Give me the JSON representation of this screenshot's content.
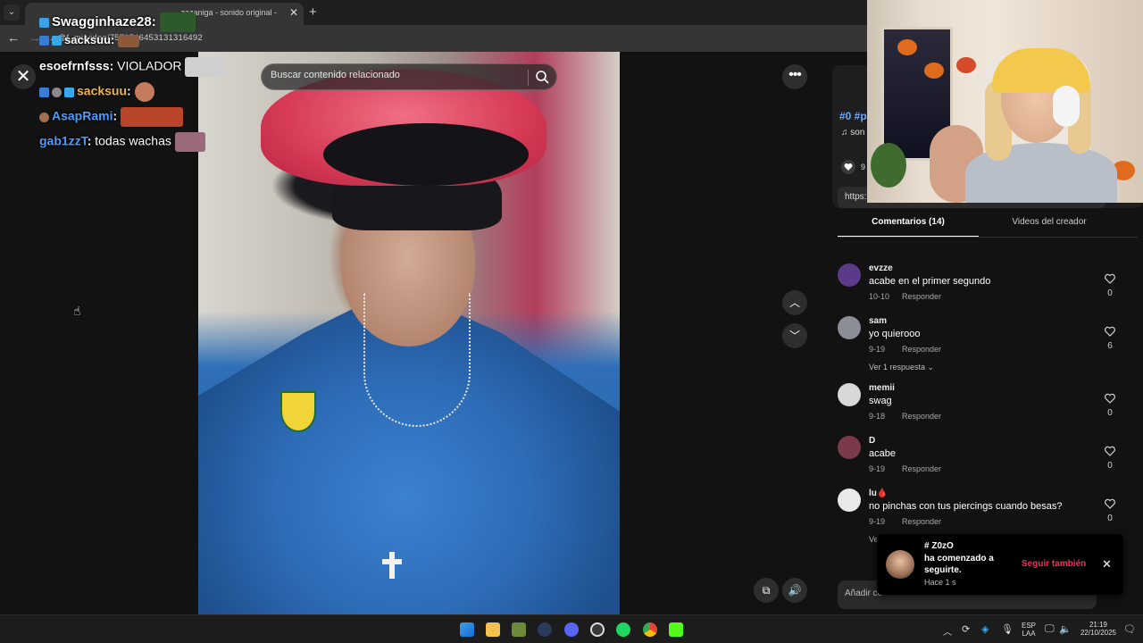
{
  "browser": {
    "tab_title": "·zazaniga - sonido original -",
    "url": "...@f..mi/video/7551546453131316492",
    "new_tab_label": "+",
    "tab_close_label": "✕"
  },
  "page": {
    "search_placeholder": "Buscar contenido relacionado",
    "close_label": "✕",
    "more_label": "•••"
  },
  "chat": [
    {
      "user": "Swagginhaze28",
      "sep": ":",
      "text": "",
      "color": "#ffffff"
    },
    {
      "user": "sacksuu",
      "sep": ":",
      "text": "",
      "color": "#ffffff"
    },
    {
      "user": "esoefrnfsss",
      "sep": ":",
      "text": " VIOLADOR",
      "color": "#ffffff"
    },
    {
      "user": "sacksuu",
      "sep": ":",
      "text": "",
      "color": "#f0b44a"
    },
    {
      "user": "AsapRami",
      "sep": ":",
      "text": "",
      "color": "#4a9cff"
    },
    {
      "user": "gab1zzT",
      "sep": ":",
      "text": " todas wachas",
      "color": "#4a9cff"
    }
  ],
  "panel": {
    "tags": "#0 #p",
    "sound": "♫  son",
    "like_count": "9",
    "link": "https:",
    "tab_comments": "Comentarios (14)",
    "tab_creator": "Videos del creador",
    "add_comment_placeholder": "Añadir co"
  },
  "comments": [
    {
      "user": "evzze",
      "text": "acabe en el primer segundo",
      "date": "10-10",
      "reply": "Responder",
      "likes": "0",
      "more": "",
      "avatar": "#5b3a8a"
    },
    {
      "user": "sam",
      "text": "yo quierooo",
      "date": "9-19",
      "reply": "Responder",
      "likes": "6",
      "more": "Ver 1 respuesta ⌄",
      "avatar": "#8b8e96"
    },
    {
      "user": "memii",
      "text": "swag",
      "date": "9-18",
      "reply": "Responder",
      "likes": "0",
      "more": "",
      "avatar": "#d8d8d8"
    },
    {
      "user": "D",
      "text": "acabe",
      "date": "9-19",
      "reply": "Responder",
      "likes": "0",
      "more": "",
      "avatar": "#7a3a4a"
    },
    {
      "user": "lu🩸",
      "text": "no pinchas con tus piercings cuando besas?",
      "date": "9-19",
      "reply": "Responder",
      "likes": "0",
      "more": "Ver 1 respuesta ⌄",
      "avatar": "#e9e9e9"
    }
  ],
  "toast": {
    "user": "# Z0zO",
    "msg_line1": "ha comenzado a",
    "msg_line2": "seguirte.",
    "time": "Hace 1 s",
    "follow_label": "Seguir también",
    "close_label": "✕"
  },
  "taskbar": {
    "lang_line1": "ESP",
    "lang_line2": "LAA",
    "time": "21:19",
    "date": "22/10/2025"
  }
}
